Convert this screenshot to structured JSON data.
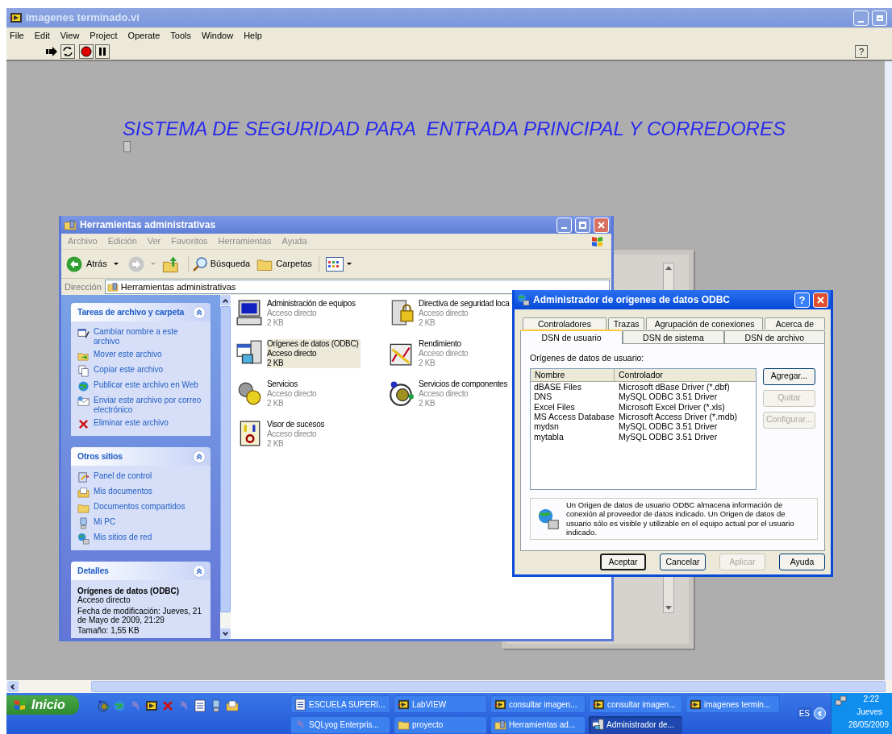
{
  "labview": {
    "title": "imagenes terminado.vi",
    "menu": [
      "File",
      "Edit",
      "View",
      "Project",
      "Operate",
      "Tools",
      "Window",
      "Help"
    ],
    "help_button": "?",
    "heading": "SISTEMA DE SEGURIDAD PARA  ENTRADA PRINCIPAL Y CORREDORES"
  },
  "explorer": {
    "title": "Herramientas administrativas",
    "menu": [
      "Archivo",
      "Edición",
      "Ver",
      "Favoritos",
      "Herramientas",
      "Ayuda"
    ],
    "toolbar": {
      "back": "Atrás",
      "search": "Búsqueda",
      "folders": "Carpetas"
    },
    "address": {
      "label": "Dirección",
      "value": "Herramientas administrativas"
    },
    "task_panels": [
      {
        "title": "Tareas de archivo y carpeta",
        "items": [
          "Cambiar nombre a este archivo",
          "Mover este archivo",
          "Copiar este archivo",
          "Publicar este archivo en Web",
          "Enviar este archivo por correo electrónico",
          "Eliminar este archivo"
        ]
      },
      {
        "title": "Otros sitios",
        "items": [
          "Panel de control",
          "Mis documentos",
          "Documentos compartidos",
          "Mi PC",
          "Mis sitios de red"
        ]
      }
    ],
    "details": {
      "title": "Detalles",
      "name": "Orígenes de datos (ODBC)",
      "type": "Acceso directo",
      "modified": "Fecha de modificación: Jueves, 21 de Mayo de 2009, 21:29",
      "size": "Tamaño: 1,55 KB"
    },
    "items": [
      {
        "name": "Administración de equipos",
        "type": "Acceso directo",
        "size": "2 KB",
        "selected": false
      },
      {
        "name": "Directiva de seguridad loca",
        "type": "Acceso directo",
        "size": "2 KB",
        "selected": false
      },
      {
        "name": "Orígenes de datos (ODBC)",
        "type": "Acceso directo",
        "size": "2 KB",
        "selected": true
      },
      {
        "name": "Rendimiento",
        "type": "Acceso directo",
        "size": "2 KB",
        "selected": false
      },
      {
        "name": "Servicios",
        "type": "Acceso directo",
        "size": "2 KB",
        "selected": false
      },
      {
        "name": "Servicios de componentes",
        "type": "Acceso directo",
        "size": "2 KB",
        "selected": false
      },
      {
        "name": "Visor de sucesos",
        "type": "Acceso directo",
        "size": "2 KB",
        "selected": false
      }
    ]
  },
  "odbc": {
    "title": "Administrador de orígenes de datos ODBC",
    "help_button": "?",
    "back_tabs": [
      "Controladores",
      "Trazas",
      "Agrupación de conexiones",
      "Acerca de"
    ],
    "tabs": [
      {
        "label": "DSN de usuario",
        "selected": true
      },
      {
        "label": "DSN de sistema",
        "selected": false
      },
      {
        "label": "DSN de archivo",
        "selected": false
      }
    ],
    "list_label": "Orígenes de datos de usuario:",
    "columns": [
      "Nombre",
      "Controlador"
    ],
    "rows": [
      [
        "dBASE Files",
        "Microsoft dBase Driver (*.dbf)"
      ],
      [
        "DNS",
        "MySQL ODBC 3.51 Driver"
      ],
      [
        "Excel Files",
        "Microsoft Excel Driver (*.xls)"
      ],
      [
        "MS Access Database",
        "Microsoft Access Driver (*.mdb)"
      ],
      [
        "mydsn",
        "MySQL ODBC 3.51 Driver"
      ],
      [
        "mytabla",
        "MySQL ODBC 3.51 Driver"
      ]
    ],
    "side_buttons": [
      {
        "label": "Agregar...",
        "disabled": false
      },
      {
        "label": "Quitar",
        "disabled": true
      },
      {
        "label": "Configurar...",
        "disabled": true
      }
    ],
    "info": "Un Origen de datos de usuario ODBC almacena información de conexión al proveedor de datos indicado. Un Origen de datos de usuario sólo es visible y utilizable en el equipo actual por el usuario indicado.",
    "buttons": [
      {
        "label": "Aceptar",
        "disabled": false,
        "default": true
      },
      {
        "label": "Cancelar",
        "disabled": false,
        "default": false
      },
      {
        "label": "Aplicar",
        "disabled": true,
        "default": false
      },
      {
        "label": "Ayuda",
        "disabled": false,
        "default": false
      }
    ]
  },
  "taskbar": {
    "start": "Inicio",
    "tasks": [
      {
        "label": "ESCUELA SUPERI...",
        "active": false
      },
      {
        "label": "LabVIEW",
        "active": false
      },
      {
        "label": "consultar imagen...",
        "active": false
      },
      {
        "label": "consultar imagen...",
        "active": false
      },
      {
        "label": "imagenes termin...",
        "active": false
      },
      {
        "label": "SQLyog Enterpris...",
        "active": false
      },
      {
        "label": "proyecto",
        "active": false
      },
      {
        "label": "Herramientas ad...",
        "active": false
      },
      {
        "label": "Administrador de...",
        "active": true
      }
    ],
    "language": "ES",
    "time": "2:22",
    "day": "Jueves",
    "date": "28/05/2009"
  }
}
